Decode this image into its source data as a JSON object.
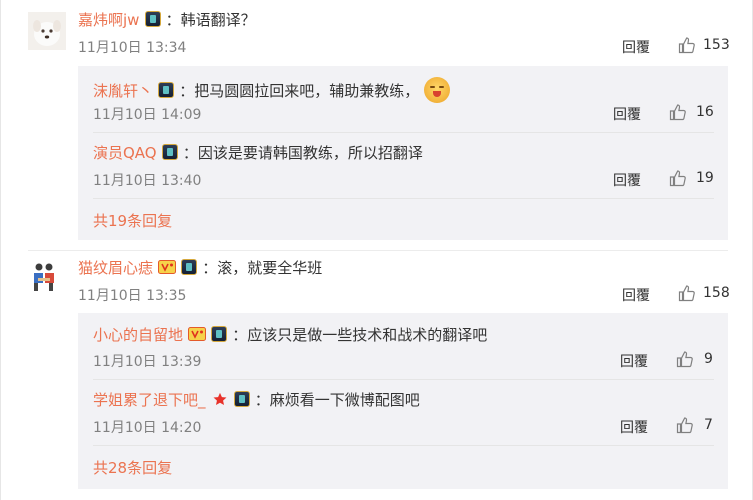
{
  "comments": [
    {
      "user": "嘉炜啊jw",
      "text": "：韩语翻译？",
      "time": "11月10日 13:34",
      "reply_label": "回覆",
      "likes": "153",
      "replies": [
        {
          "user": "沫胤轩丶",
          "text": "：把马圆圆拉回来吧，辅助兼教练，",
          "time": "11月10日 14:09",
          "reply_label": "回覆",
          "likes": "16"
        },
        {
          "user": "演员QAQ",
          "text": "：因该是要请韩国教练，所以招翻译",
          "time": "11月10日 13:40",
          "reply_label": "回覆",
          "likes": "19"
        }
      ],
      "more": "共19条回复"
    },
    {
      "user": "猫纹眉心痣",
      "text": "：滚，就要全华班",
      "time": "11月10日 13:35",
      "reply_label": "回覆",
      "likes": "158",
      "replies": [
        {
          "user": "小心的自留地",
          "text": "：应该只是做一些技术和战术的翻译吧",
          "time": "11月10日 13:39",
          "reply_label": "回覆",
          "likes": "9"
        },
        {
          "user": "学姐累了退下吧_",
          "text": "：麻烦看一下微博配图吧",
          "time": "11月10日 14:20",
          "reply_label": "回覆",
          "likes": "7"
        }
      ],
      "more": "共28条回复"
    }
  ],
  "icons": {
    "like": "thumbs-up-icon",
    "badge": "game-badge-icon",
    "vip": "vip-badge-icon"
  },
  "colors": {
    "username": "#eb7350",
    "meta": "#808080",
    "subbox": "#f2f2f5"
  }
}
